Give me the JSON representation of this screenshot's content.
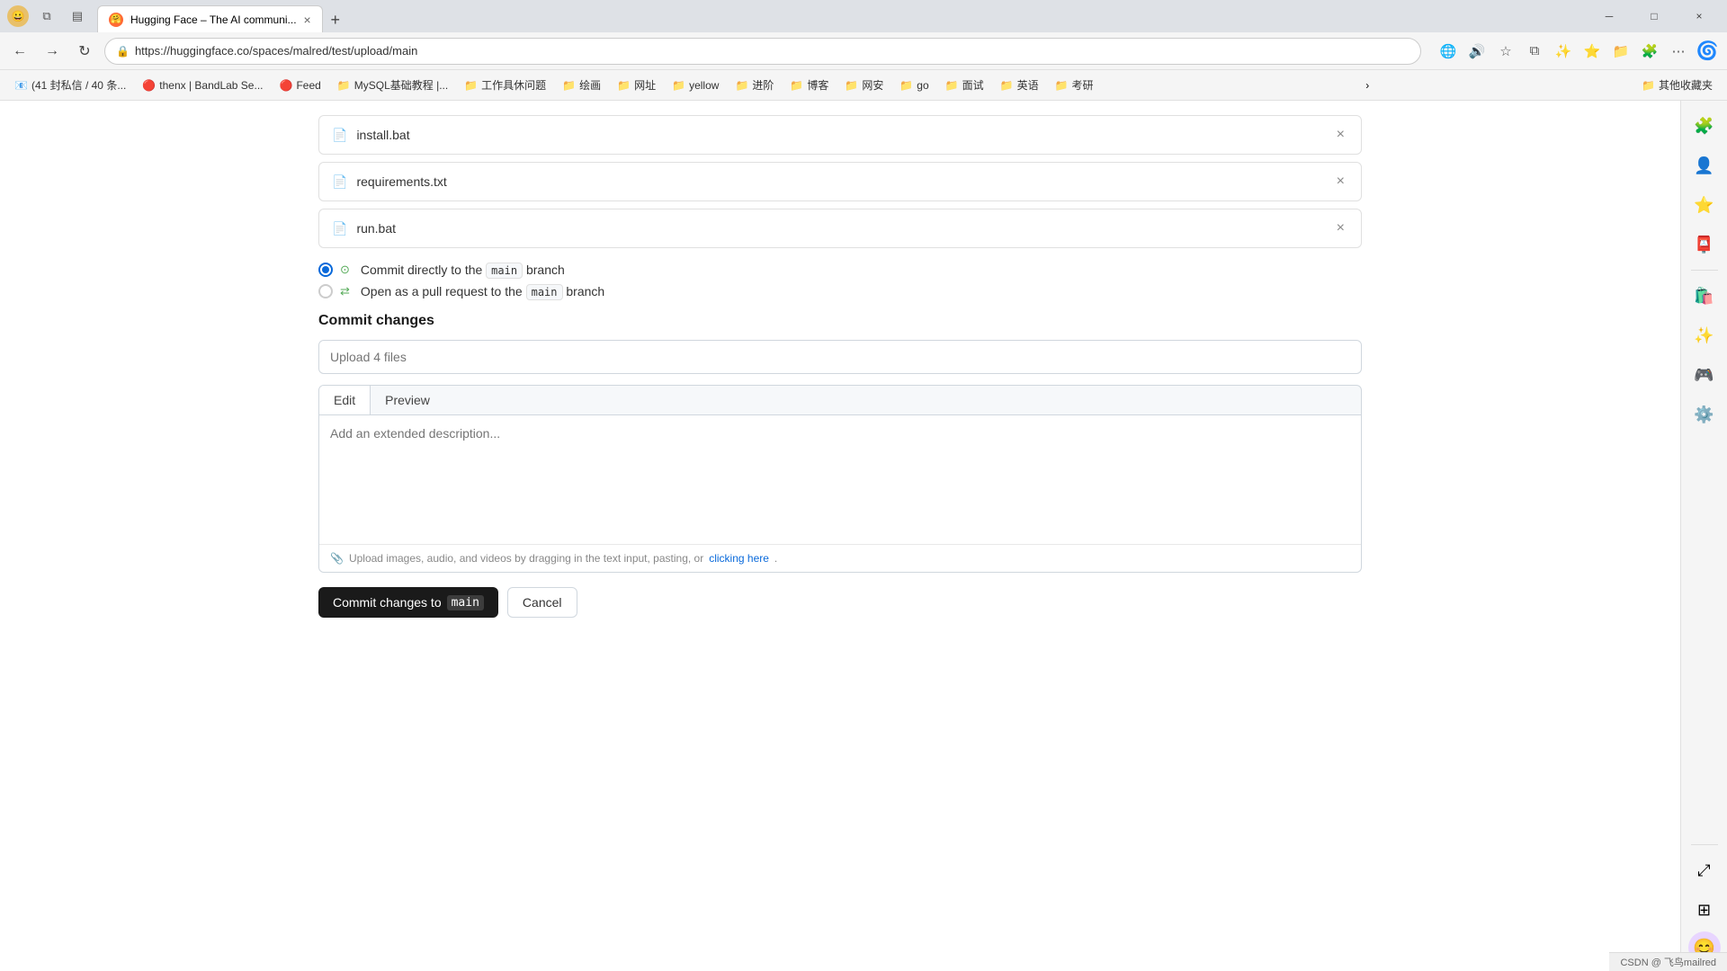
{
  "browser": {
    "tab": {
      "favicon_color": "#ff6b35",
      "title": "Hugging Face – The AI communi...",
      "close_icon": "×"
    },
    "new_tab_icon": "+",
    "window_controls": {
      "minimize": "─",
      "maximize": "□",
      "close": "×"
    },
    "address_bar": {
      "url": "https://huggingface.co/spaces/malred/test/upload/main",
      "lock_icon": "🔒"
    },
    "nav": {
      "back": "←",
      "forward": "→",
      "refresh": "↻"
    }
  },
  "bookmarks": [
    {
      "icon": "📧",
      "label": "(41 封私信 / 40 条..."
    },
    {
      "icon": "🔴",
      "label": "thenx | BandLab Se..."
    },
    {
      "icon": "🔴",
      "label": "Feed"
    },
    {
      "icon": "📁",
      "label": "MySQL基础教程 |..."
    },
    {
      "icon": "📁",
      "label": "工作具休问题"
    },
    {
      "icon": "📁",
      "label": "绘画"
    },
    {
      "icon": "📁",
      "label": "网址"
    },
    {
      "icon": "📁",
      "label": "yellow"
    },
    {
      "icon": "📁",
      "label": "进阶"
    },
    {
      "icon": "📁",
      "label": "博客"
    },
    {
      "icon": "📁",
      "label": "网安"
    },
    {
      "icon": "📁",
      "label": "go"
    },
    {
      "icon": "📁",
      "label": "面试"
    },
    {
      "icon": "📁",
      "label": "英语"
    },
    {
      "icon": "📁",
      "label": "考研"
    }
  ],
  "bookmarks_extra": "其他收藏夹",
  "files": [
    {
      "name": "install.bat",
      "icon": "📄"
    },
    {
      "name": "requirements.txt",
      "icon": "📄"
    },
    {
      "name": "run.bat",
      "icon": "📄"
    }
  ],
  "radio_options": [
    {
      "id": "commit-direct",
      "checked": true,
      "indicator_icon": "⊙",
      "label_prefix": "Commit directly to the ",
      "branch": "main",
      "label_suffix": " branch"
    },
    {
      "id": "open-pr",
      "checked": false,
      "indicator_icon": "⇄",
      "label_prefix": "Open as a pull request to the ",
      "branch": "main",
      "label_suffix": " branch"
    }
  ],
  "commit_section": {
    "title": "Commit changes",
    "input_placeholder": "Upload 4 files",
    "tabs": [
      {
        "label": "Edit",
        "active": true
      },
      {
        "label": "Preview",
        "active": false
      }
    ],
    "description_placeholder": "Add an extended description...",
    "upload_hint_text": "Upload images, audio, and videos by dragging in the text input, pasting, or ",
    "upload_hint_link": "clicking here",
    "upload_hint_end": ".",
    "upload_icon": "📎"
  },
  "action_buttons": {
    "commit_label_prefix": "Commit changes to ",
    "commit_branch": "main",
    "cancel_label": "Cancel"
  },
  "right_sidebar": {
    "icons": [
      {
        "name": "extensions-icon",
        "symbol": "🧩"
      },
      {
        "name": "user-icon",
        "symbol": "👤"
      },
      {
        "name": "star-icon",
        "symbol": "⭐"
      },
      {
        "name": "outlook-icon",
        "symbol": "📮"
      },
      {
        "name": "shopping-icon",
        "symbol": "🛍️"
      },
      {
        "name": "copilot-icon",
        "symbol": "🤖"
      },
      {
        "name": "games-icon",
        "symbol": "🎮"
      },
      {
        "name": "settings-icon",
        "symbol": "⚙️"
      },
      {
        "name": "expand-icon",
        "symbol": "⤢"
      },
      {
        "name": "grid-icon",
        "symbol": "⊞"
      },
      {
        "name": "avatar-icon",
        "symbol": "😊"
      }
    ]
  },
  "status_bar": {
    "text": "CSDN @ 飞鸟mailred"
  }
}
